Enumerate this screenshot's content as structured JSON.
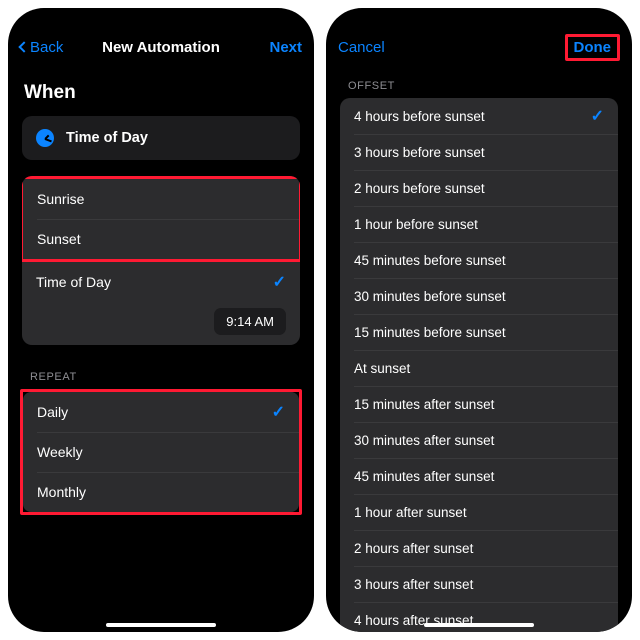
{
  "left": {
    "nav": {
      "back": "Back",
      "title": "New Automation",
      "next": "Next"
    },
    "when_label": "When",
    "chip": {
      "label": "Time of Day"
    },
    "time_options": [
      {
        "label": "Sunrise",
        "selected": false
      },
      {
        "label": "Sunset",
        "selected": false
      },
      {
        "label": "Time of Day",
        "selected": true
      }
    ],
    "time_value": "9:14 AM",
    "repeat_header": "REPEAT",
    "repeat_options": [
      {
        "label": "Daily",
        "selected": true
      },
      {
        "label": "Weekly",
        "selected": false
      },
      {
        "label": "Monthly",
        "selected": false
      }
    ]
  },
  "right": {
    "nav": {
      "cancel": "Cancel",
      "done": "Done"
    },
    "offset_header": "OFFSET",
    "offsets": [
      {
        "label": "4 hours before sunset",
        "selected": true
      },
      {
        "label": "3 hours before sunset",
        "selected": false
      },
      {
        "label": "2 hours before sunset",
        "selected": false
      },
      {
        "label": "1 hour before sunset",
        "selected": false
      },
      {
        "label": "45 minutes before sunset",
        "selected": false
      },
      {
        "label": "30 minutes before sunset",
        "selected": false
      },
      {
        "label": "15 minutes before sunset",
        "selected": false
      },
      {
        "label": "At sunset",
        "selected": false
      },
      {
        "label": "15 minutes after sunset",
        "selected": false
      },
      {
        "label": "30 minutes after sunset",
        "selected": false
      },
      {
        "label": "45 minutes after sunset",
        "selected": false
      },
      {
        "label": "1 hour after sunset",
        "selected": false
      },
      {
        "label": "2 hours after sunset",
        "selected": false
      },
      {
        "label": "3 hours after sunset",
        "selected": false
      },
      {
        "label": "4 hours after sunset",
        "selected": false
      }
    ]
  },
  "checkmark_glyph": "✓"
}
